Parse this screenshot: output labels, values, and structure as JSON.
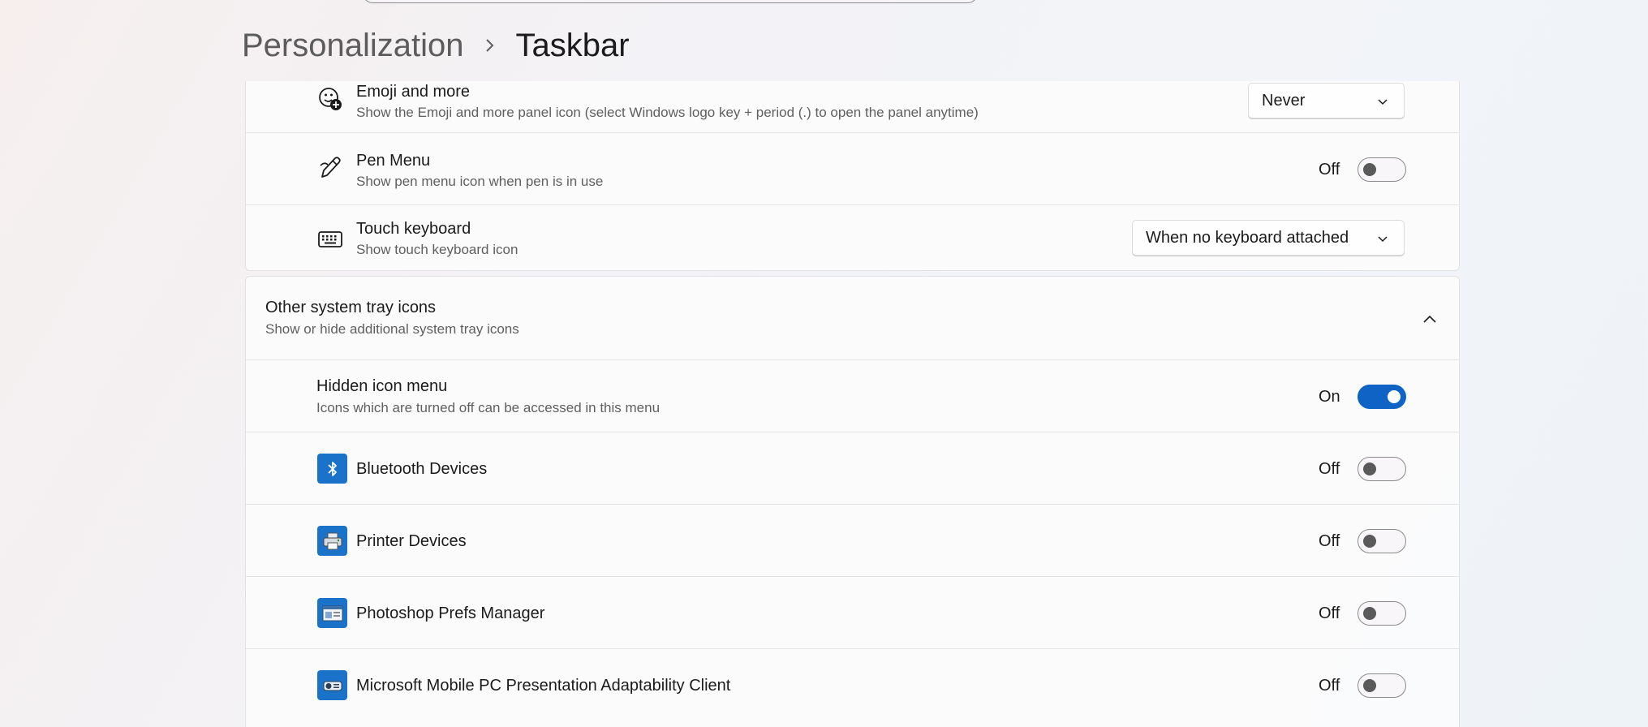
{
  "breadcrumb": {
    "parent": "Personalization",
    "current": "Taskbar"
  },
  "corner_icons": [
    {
      "title": "Emoji and more",
      "subtitle": "Show the Emoji and more panel icon (select Windows logo key + period (.) to open the panel anytime)",
      "control": "dropdown",
      "value": "Never",
      "icon": "emoji-add-icon"
    },
    {
      "title": "Pen Menu",
      "subtitle": "Show pen menu icon when pen is in use",
      "control": "toggle",
      "state_label": "Off",
      "on": false,
      "icon": "pen-icon"
    },
    {
      "title": "Touch keyboard",
      "subtitle": "Show touch keyboard icon",
      "control": "dropdown",
      "value": "When no keyboard attached",
      "icon": "keyboard-icon"
    }
  ],
  "other_tray": {
    "title": "Other system tray icons",
    "subtitle": "Show or hide additional system tray icons",
    "expanded": true,
    "hidden_menu": {
      "title": "Hidden icon menu",
      "subtitle": "Icons which are turned off can be accessed in this menu",
      "state_label": "On",
      "on": true
    },
    "items": [
      {
        "title": "Bluetooth Devices",
        "state_label": "Off",
        "on": false,
        "icon": "bluetooth-icon"
      },
      {
        "title": "Printer Devices",
        "state_label": "Off",
        "on": false,
        "icon": "printer-icon"
      },
      {
        "title": "Photoshop Prefs Manager",
        "state_label": "Off",
        "on": false,
        "icon": "app-window-icon"
      },
      {
        "title": "Microsoft Mobile PC Presentation Adaptability Client",
        "state_label": "Off",
        "on": false,
        "icon": "projector-icon"
      }
    ]
  },
  "colors": {
    "accent": "#0f63c4",
    "tray_icon_bg": "#1a73c8"
  }
}
